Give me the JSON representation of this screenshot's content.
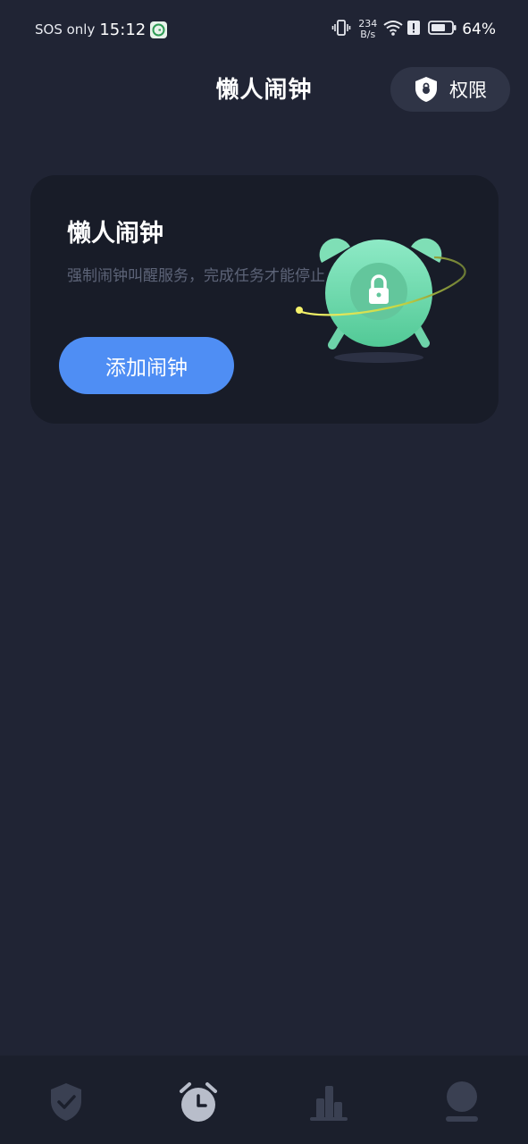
{
  "status_bar": {
    "carrier_text": "SOS only",
    "time": "15:12",
    "net_speed_value": "234",
    "net_speed_unit": "B/s",
    "battery_percent": "64%"
  },
  "header": {
    "title": "懒人闹钟",
    "permission_button_label": "权限"
  },
  "card": {
    "title": "懒人闹钟",
    "description": "强制闹钟叫醒服务，完成任务才能停止",
    "add_button_label": "添加闹钟"
  },
  "bottom_nav": {
    "items": [
      {
        "icon": "shield-check-icon",
        "active": false
      },
      {
        "icon": "alarm-clock-icon",
        "active": true
      },
      {
        "icon": "bar-chart-icon",
        "active": false
      },
      {
        "icon": "profile-icon",
        "active": false
      }
    ]
  },
  "colors": {
    "background": "#202434",
    "card": "#181c28",
    "accent_button": "#4f8ef4",
    "illustration_green": "#7fe3b8",
    "nav_active": "#b8bdca",
    "nav_inactive": "#3a4052"
  }
}
